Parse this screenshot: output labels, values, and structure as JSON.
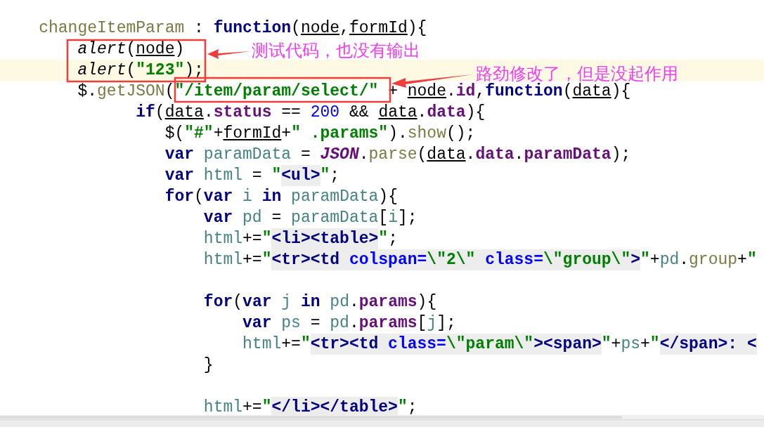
{
  "code": {
    "lines": [
      {
        "current": false,
        "tokens": [
          {
            "text": "    changeItemParam",
            "kind": "method"
          },
          {
            "text": " : ",
            "kind": "plain"
          },
          {
            "text": "function",
            "kind": "kw"
          },
          {
            "text": "(",
            "kind": "plain"
          },
          {
            "text": "node",
            "kind": "param"
          },
          {
            "text": ",",
            "kind": "plain"
          },
          {
            "text": "formId",
            "kind": "param"
          },
          {
            "text": "){",
            "kind": "plain"
          }
        ]
      },
      {
        "current": false,
        "tokens": [
          {
            "text": "        alert",
            "kind": "italic"
          },
          {
            "text": "(",
            "kind": "plain"
          },
          {
            "text": "node",
            "kind": "param"
          },
          {
            "text": ")",
            "kind": "plain"
          }
        ]
      },
      {
        "current": true,
        "tokens": [
          {
            "text": "        alert",
            "kind": "italic"
          },
          {
            "text": "(",
            "kind": "plain"
          },
          {
            "text": "\"123\"",
            "kind": "str"
          },
          {
            "text": ");",
            "kind": "plain"
          }
        ]
      },
      {
        "current": false,
        "tokens": [
          {
            "text": "        $.",
            "kind": "plain"
          },
          {
            "text": "getJSON",
            "kind": "method"
          },
          {
            "text": "(",
            "kind": "plain"
          },
          {
            "text": "\"/item/param/select/\"",
            "kind": "str"
          },
          {
            "text": " + ",
            "kind": "plain"
          },
          {
            "text": "node",
            "kind": "param"
          },
          {
            "text": ".",
            "kind": "plain"
          },
          {
            "text": "id",
            "kind": "prop"
          },
          {
            "text": ",",
            "kind": "plain"
          },
          {
            "text": "function",
            "kind": "kw"
          },
          {
            "text": "(",
            "kind": "plain"
          },
          {
            "text": "data",
            "kind": "param"
          },
          {
            "text": "){",
            "kind": "plain"
          }
        ]
      },
      {
        "current": false,
        "tokens": [
          {
            "text": "              if",
            "kind": "kw"
          },
          {
            "text": "(",
            "kind": "plain"
          },
          {
            "text": "data",
            "kind": "param"
          },
          {
            "text": ".",
            "kind": "plain"
          },
          {
            "text": "status",
            "kind": "prop"
          },
          {
            "text": " == ",
            "kind": "plain"
          },
          {
            "text": "200",
            "kind": "num"
          },
          {
            "text": " && ",
            "kind": "plain"
          },
          {
            "text": "data",
            "kind": "param"
          },
          {
            "text": ".",
            "kind": "plain"
          },
          {
            "text": "data",
            "kind": "prop"
          },
          {
            "text": "){",
            "kind": "plain"
          }
        ]
      },
      {
        "current": false,
        "tokens": [
          {
            "text": "                 $(",
            "kind": "plain"
          },
          {
            "text": "\"#\"",
            "kind": "str"
          },
          {
            "text": "+",
            "kind": "plain"
          },
          {
            "text": "formId",
            "kind": "param"
          },
          {
            "text": "+",
            "kind": "plain"
          },
          {
            "text": "\" .params\"",
            "kind": "str"
          },
          {
            "text": ").",
            "kind": "plain"
          },
          {
            "text": "show",
            "kind": "method"
          },
          {
            "text": "();",
            "kind": "plain"
          }
        ]
      },
      {
        "current": false,
        "tokens": [
          {
            "text": "                 var",
            "kind": "kw"
          },
          {
            "text": " paramData",
            "kind": "local"
          },
          {
            "text": " = ",
            "kind": "plain"
          },
          {
            "text": "JSON",
            "kind": "global"
          },
          {
            "text": ".",
            "kind": "plain"
          },
          {
            "text": "parse",
            "kind": "method"
          },
          {
            "text": "(",
            "kind": "plain"
          },
          {
            "text": "data",
            "kind": "param"
          },
          {
            "text": ".",
            "kind": "plain"
          },
          {
            "text": "data",
            "kind": "prop"
          },
          {
            "text": ".",
            "kind": "plain"
          },
          {
            "text": "paramData",
            "kind": "prop"
          },
          {
            "text": ");",
            "kind": "plain"
          }
        ]
      },
      {
        "current": false,
        "tokens": [
          {
            "text": "                 var",
            "kind": "kw"
          },
          {
            "text": " html",
            "kind": "local"
          },
          {
            "text": " = ",
            "kind": "plain"
          },
          {
            "text": "\"",
            "kind": "str"
          },
          {
            "text": "<ul>",
            "kind": "tag"
          },
          {
            "text": "\"",
            "kind": "str"
          },
          {
            "text": ";",
            "kind": "plain"
          }
        ]
      },
      {
        "current": false,
        "tokens": [
          {
            "text": "                 for",
            "kind": "kw"
          },
          {
            "text": "(",
            "kind": "plain"
          },
          {
            "text": "var",
            "kind": "kw"
          },
          {
            "text": " i ",
            "kind": "local"
          },
          {
            "text": "in",
            "kind": "kw"
          },
          {
            "text": " paramData",
            "kind": "local"
          },
          {
            "text": "){",
            "kind": "plain"
          }
        ]
      },
      {
        "current": false,
        "tokens": [
          {
            "text": "                     var",
            "kind": "kw"
          },
          {
            "text": " pd",
            "kind": "local"
          },
          {
            "text": " = ",
            "kind": "plain"
          },
          {
            "text": "paramData",
            "kind": "local"
          },
          {
            "text": "[",
            "kind": "plain"
          },
          {
            "text": "i",
            "kind": "local"
          },
          {
            "text": "];",
            "kind": "plain"
          }
        ]
      },
      {
        "current": false,
        "tokens": [
          {
            "text": "                     html",
            "kind": "local"
          },
          {
            "text": "+=",
            "kind": "plain"
          },
          {
            "text": "\"",
            "kind": "str"
          },
          {
            "text": "<li><table>",
            "kind": "tag"
          },
          {
            "text": "\"",
            "kind": "str"
          },
          {
            "text": ";",
            "kind": "plain"
          }
        ]
      },
      {
        "current": false,
        "tokens": [
          {
            "text": "                     html",
            "kind": "local"
          },
          {
            "text": "+=",
            "kind": "plain"
          },
          {
            "text": "\"",
            "kind": "str"
          },
          {
            "text": "<tr><td ",
            "kind": "tag"
          },
          {
            "text": "colspan=",
            "kind": "attr"
          },
          {
            "text": "\\\"2\\\"",
            "kind": "attrval"
          },
          {
            "text": " class=",
            "kind": "attr"
          },
          {
            "text": "\\\"group\\\"",
            "kind": "attrval"
          },
          {
            "text": ">",
            "kind": "tag"
          },
          {
            "text": "\"",
            "kind": "str"
          },
          {
            "text": "+",
            "kind": "plain"
          },
          {
            "text": "pd",
            "kind": "local"
          },
          {
            "text": ".",
            "kind": "plain"
          },
          {
            "text": "group",
            "kind": "method"
          },
          {
            "text": "+",
            "kind": "plain"
          },
          {
            "text": "\"",
            "kind": "str"
          }
        ]
      },
      {
        "current": false
      },
      {
        "current": false,
        "tokens": [
          {
            "text": "                     for",
            "kind": "kw"
          },
          {
            "text": "(",
            "kind": "plain"
          },
          {
            "text": "var",
            "kind": "kw"
          },
          {
            "text": " j ",
            "kind": "local"
          },
          {
            "text": "in",
            "kind": "kw"
          },
          {
            "text": " pd",
            "kind": "local"
          },
          {
            "text": ".",
            "kind": "plain"
          },
          {
            "text": "params",
            "kind": "prop"
          },
          {
            "text": "){",
            "kind": "plain"
          }
        ]
      },
      {
        "current": false,
        "tokens": [
          {
            "text": "                         var",
            "kind": "kw"
          },
          {
            "text": " ps",
            "kind": "local"
          },
          {
            "text": " = ",
            "kind": "plain"
          },
          {
            "text": "pd",
            "kind": "local"
          },
          {
            "text": ".",
            "kind": "plain"
          },
          {
            "text": "params",
            "kind": "prop"
          },
          {
            "text": "[",
            "kind": "plain"
          },
          {
            "text": "j",
            "kind": "local"
          },
          {
            "text": "];",
            "kind": "plain"
          }
        ]
      },
      {
        "current": false,
        "tokens": [
          {
            "text": "                         html",
            "kind": "local"
          },
          {
            "text": "+=",
            "kind": "plain"
          },
          {
            "text": "\"",
            "kind": "str"
          },
          {
            "text": "<tr><td ",
            "kind": "tag"
          },
          {
            "text": "class=",
            "kind": "attr"
          },
          {
            "text": "\\\"param\\\"",
            "kind": "attrval"
          },
          {
            "text": "><span>",
            "kind": "tag"
          },
          {
            "text": "\"",
            "kind": "str"
          },
          {
            "text": "+",
            "kind": "plain"
          },
          {
            "text": "ps",
            "kind": "local"
          },
          {
            "text": "+",
            "kind": "plain"
          },
          {
            "text": "\"",
            "kind": "str"
          },
          {
            "text": "</span>: <",
            "kind": "tag"
          }
        ]
      },
      {
        "current": false,
        "tokens": [
          {
            "text": "                     }",
            "kind": "plain"
          }
        ]
      },
      {
        "current": false
      },
      {
        "current": false,
        "tokens": [
          {
            "text": "                     html",
            "kind": "local"
          },
          {
            "text": "+=",
            "kind": "plain"
          },
          {
            "text": "\"",
            "kind": "str"
          },
          {
            "text": "</li></table>",
            "kind": "tag"
          },
          {
            "text": "\"",
            "kind": "str"
          },
          {
            "text": ";",
            "kind": "plain"
          }
        ]
      }
    ]
  },
  "annotations": [
    {
      "text": "测试代码，也没有输出"
    },
    {
      "text": "路劲修改了，但是没起作用"
    }
  ]
}
